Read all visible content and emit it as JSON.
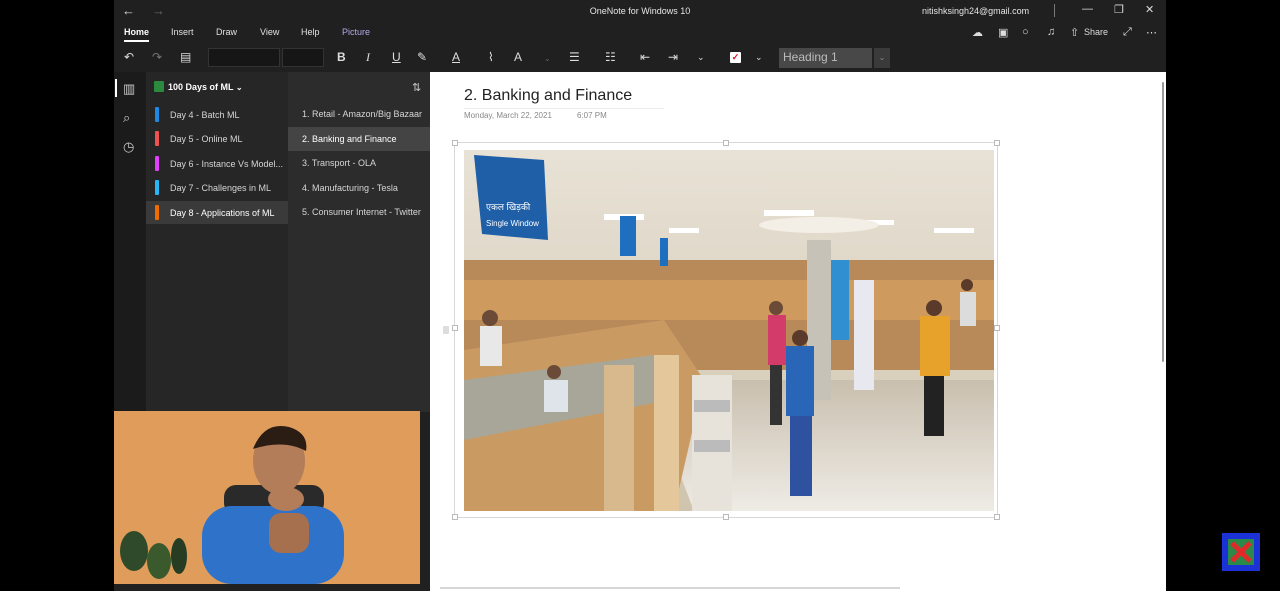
{
  "window": {
    "title": "OneNote for Windows 10",
    "account": "nitishksingh24@gmail.com",
    "back_glyph": "←",
    "forward_glyph": "→",
    "minimize_glyph": "—",
    "maximize_glyph": "❐",
    "close_glyph": "✕"
  },
  "ribbon": {
    "tabs": [
      "Home",
      "Insert",
      "Draw",
      "View",
      "Help",
      "Picture"
    ],
    "share_label": "Share",
    "icons": [
      "sync-icon",
      "notebook-icon",
      "lightbulb-icon",
      "bell-icon",
      "share-icon",
      "expand-icon",
      "more-icon"
    ]
  },
  "toolbar": {
    "style_value": "Heading 1",
    "bold": "B",
    "italic": "I",
    "underline": "U"
  },
  "notebook": {
    "name": "100 Days of ML",
    "sections": [
      {
        "label": "Day 4 - Batch ML",
        "color": "#1e88e5"
      },
      {
        "label": "Day 5 - Online ML",
        "color": "#ef5350"
      },
      {
        "label": "Day 6 - Instance Vs Model...",
        "color": "#e040fb"
      },
      {
        "label": "Day 7 - Challenges in ML",
        "color": "#29b6f6"
      },
      {
        "label": "Day 8 - Applications of ML",
        "color": "#ef6c00"
      }
    ],
    "active_section": 4
  },
  "pages": {
    "items": [
      "1. Retail - Amazon/Big Bazaar",
      "2. Banking and Finance",
      "3. Transport - OLA",
      "4. Manufacturing - Tesla",
      "5. Consumer Internet - Twitter"
    ],
    "active_page": 1
  },
  "page": {
    "title": "2. Banking and Finance",
    "date": "Monday, March 22, 2021",
    "time": "6:07 PM",
    "image_sign": "एकल खिड़की",
    "image_sign_en": "Single Window"
  },
  "colors": {
    "app_bg": "#202020",
    "accent_picture_tab": "#b7a6e8",
    "canvas_bg": "#ffffff"
  }
}
